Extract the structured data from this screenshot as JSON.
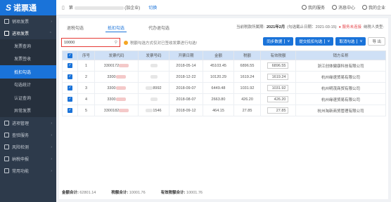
{
  "app": {
    "logo_text": "诺票通"
  },
  "topbar": {
    "company_prefix": "第",
    "company_suffix": "(加企业)",
    "switch_label": "切换",
    "my_service": "我的服务",
    "messages": "消息中心",
    "my_company": "我的企业"
  },
  "sidebar": {
    "items": [
      {
        "label": "销项发票",
        "icon": "invoice-icon",
        "arrow": "›"
      },
      {
        "label": "进项发票",
        "icon": "inbox-icon",
        "arrow": "⌄"
      }
    ],
    "sub_items": [
      {
        "label": "发票查询"
      },
      {
        "label": "发票签收"
      },
      {
        "label": "抵扣勾选"
      },
      {
        "label": "勾选统计"
      },
      {
        "label": "认证查询"
      },
      {
        "label": "异常发票"
      }
    ],
    "bottom_items": [
      {
        "label": "进项管理",
        "icon": "manage-icon"
      },
      {
        "label": "查验服务",
        "icon": "verify-icon"
      },
      {
        "label": "风险检测",
        "icon": "risk-icon"
      },
      {
        "label": "纳税申报",
        "icon": "tax-icon"
      },
      {
        "label": "常用功能",
        "icon": "common-icon"
      }
    ]
  },
  "tabs": [
    "退税勾选",
    "抵扣勾选",
    "代办退勾选"
  ],
  "period": {
    "label": "当前税款所属期:",
    "value": "2021年2月",
    "deadline": "(勾选截止日期：2021-03-15)",
    "warn": "● 服务未连接",
    "type": "纳税人类型:"
  },
  "search": {
    "value": "10000",
    "placeholder": "请输入发票代码"
  },
  "hint": "税额勾选方式仅对已签收发票进行勾选!",
  "buttons": {
    "sync": "同步数据",
    "submit": "提交抵扣勾选",
    "cancel": "取消勾选",
    "export": "导 出"
  },
  "table": {
    "headers": [
      "序号",
      "发票代码",
      "发票号码",
      "开票日期",
      "金额",
      "税额",
      "有效税额",
      "销方名称"
    ],
    "rows": [
      {
        "no": "1",
        "code": "3300172",
        "num": "",
        "date": "2018-05-14",
        "amount": "45103.45",
        "tax": "6896.55",
        "eff": "6896.55",
        "seller": "浙江创体健康科技有限公司"
      },
      {
        "no": "2",
        "code": "3300",
        "num": "",
        "date": "2018-12-22",
        "amount": "10120.29",
        "tax": "1619.24",
        "eff": "1619.24",
        "seller": "杭州缘速贸易有限公司"
      },
      {
        "no": "3",
        "code": "3300",
        "num": "8992",
        "date": "2018-09-07",
        "amount": "6449.48",
        "tax": "1031.92",
        "eff": "1031.92",
        "seller": "杭州明茂商贸有限公司"
      },
      {
        "no": "4",
        "code": "3300",
        "num": "",
        "date": "2018-08-07",
        "amount": "2663.80",
        "tax": "426.20",
        "eff": "426.20",
        "seller": "杭州缘速贸易有限公司"
      },
      {
        "no": "5",
        "code": "3300182",
        "num": "1546",
        "date": "2018-09-12",
        "amount": "464.15",
        "tax": "27.85",
        "eff": "27.85",
        "seller": "杭州淘新商贸管理有限公司"
      }
    ]
  },
  "footer": {
    "amount_label": "金额合计:",
    "amount_value": "62801.14",
    "tax_label": "税额合计:",
    "tax_value": "10001.76",
    "eff_label": "有效税额合计:",
    "eff_value": "10001.76"
  }
}
